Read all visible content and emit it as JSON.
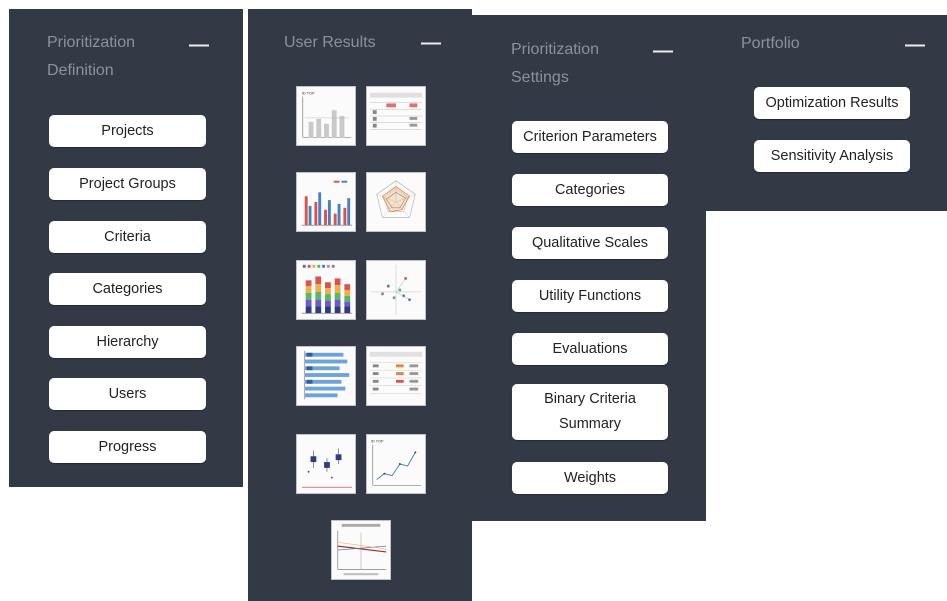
{
  "prioritization_definition": {
    "title_line1": "Prioritization",
    "title_line2": "Definition",
    "collapse": "—",
    "buttons": [
      "Projects",
      "Project Groups",
      "Criteria",
      "Categories",
      "Hierarchy",
      "Users",
      "Progress"
    ]
  },
  "user_results": {
    "title": "User Results",
    "collapse": "—",
    "thumbnails": [
      "bar-chart-icon",
      "table-icon",
      "grouped-bar-chart-icon",
      "radar-chart-icon",
      "stacked-bar-chart-icon",
      "scatter-plot-icon",
      "horizontal-bar-chart-icon",
      "data-table-icon",
      "box-plot-icon",
      "line-chart-icon",
      "sensitivity-line-chart-icon"
    ]
  },
  "prioritization_settings": {
    "title_line1": "Prioritization",
    "title_line2": "Settings",
    "collapse": "—",
    "buttons": [
      "Criterion Parameters",
      "Categories",
      "Qualitative Scales",
      "Utility Functions",
      "Evaluations"
    ],
    "binary_line1": "Binary Criteria",
    "binary_line2": "Summary",
    "weights": "Weights"
  },
  "portfolio": {
    "title": "Portfolio",
    "collapse": "—",
    "buttons": [
      "Optimization Results",
      "Sensitivity Analysis"
    ]
  },
  "colors": {
    "panel_bg": "#333a45",
    "title_text": "#8c929b",
    "button_bg": "#ffffff"
  }
}
